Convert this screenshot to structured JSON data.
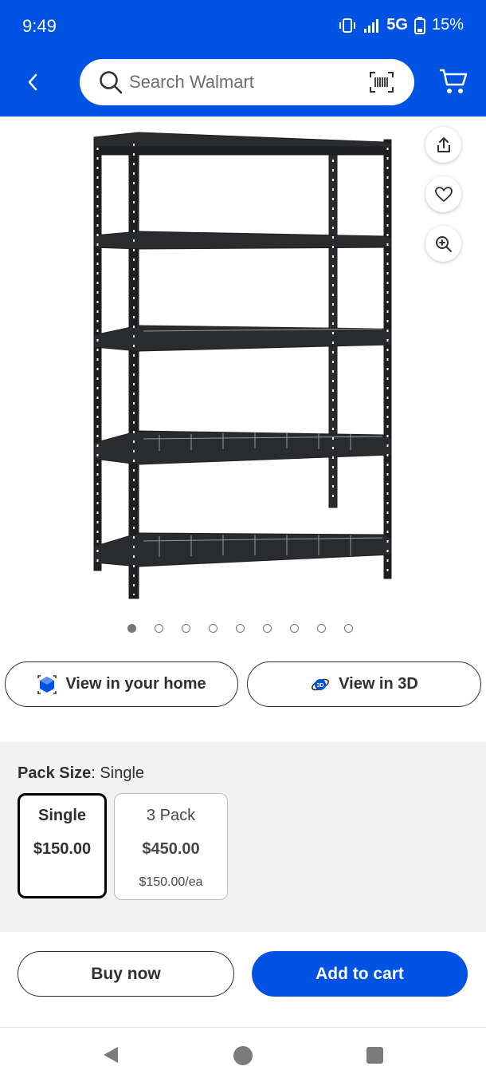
{
  "status_bar": {
    "time": "9:49",
    "network": "5G",
    "battery": "15%"
  },
  "search": {
    "placeholder": "Search Walmart"
  },
  "icons": {
    "back": "chevron-left-icon",
    "search": "search-icon",
    "barcode": "barcode-scan-icon",
    "cart": "cart-icon",
    "share": "share-icon",
    "favorite": "heart-icon",
    "zoom": "zoom-in-icon",
    "ar": "ar-cube-icon",
    "view3d": "3d-view-icon"
  },
  "gallery": {
    "image_count": 9,
    "active_index": 0
  },
  "view_buttons": {
    "home_label": "View in your home",
    "threed_label": "View in 3D"
  },
  "pack_size": {
    "label": "Pack Size",
    "selected_value": "Single",
    "options": [
      {
        "label": "Single",
        "price": "$150.00",
        "unit_price": ""
      },
      {
        "label": "3 Pack",
        "price": "$450.00",
        "unit_price": "$150.00/ea"
      }
    ]
  },
  "actions": {
    "buy_now": "Buy now",
    "add_to_cart": "Add to cart"
  },
  "colors": {
    "brand_blue": "#0053e2",
    "text_dark": "#2e2f32",
    "section_bg": "#f2f2f2"
  }
}
